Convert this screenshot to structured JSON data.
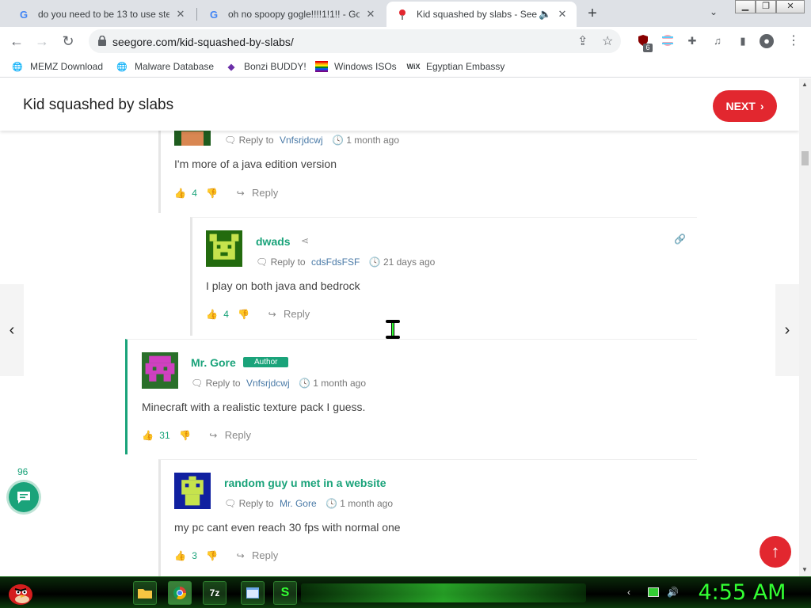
{
  "browser": {
    "tabs": [
      {
        "title": "do you need to be 13 to use stea",
        "favicon": "google-icon"
      },
      {
        "title": "oh no spoopy gogle!!!!1!1!! - Go",
        "favicon": "google-icon"
      },
      {
        "title": "Kid squashed by slabs - See",
        "favicon": "seegore-icon",
        "active": true,
        "audio": true
      }
    ],
    "url": "seegore.com/kid-squashed-by-slabs/",
    "extension_badge": "6",
    "bookmarks": [
      {
        "label": "MEMZ Download",
        "icon": "globe-icon"
      },
      {
        "label": "Malware Database",
        "icon": "globe-icon"
      },
      {
        "label": "Bonzi BUDDY!",
        "icon": "bonzi-icon"
      },
      {
        "label": "Windows ISOs",
        "icon": "rainbow-flag-icon"
      },
      {
        "label": "Egyptian Embassy",
        "icon": "wix-icon"
      }
    ]
  },
  "site": {
    "title": "Kid squashed by slabs",
    "next_label": "NEXT"
  },
  "comments": [
    {
      "name": "",
      "reply_prefix": "Reply to",
      "reply_to": "Vnfsrjdcwj",
      "time": "1 month ago",
      "text": "I'm more of a java edition version",
      "likes": "4",
      "reply_label": "Reply"
    },
    {
      "name": "dwads",
      "reply_prefix": "Reply to",
      "reply_to": "cdsFdsFSF",
      "time": "21 days ago",
      "text": "I play on both java and bedrock",
      "likes": "4",
      "reply_label": "Reply"
    },
    {
      "name": "Mr. Gore",
      "badge": "Author",
      "reply_prefix": "Reply to",
      "reply_to": "Vnfsrjdcwj",
      "time": "1 month ago",
      "text": "Minecraft with a realistic texture pack I guess.",
      "likes": "31",
      "reply_label": "Reply"
    },
    {
      "name": "random guy u met in a website",
      "reply_prefix": "Reply to",
      "reply_to": "Mr. Gore",
      "time": "1 month ago",
      "text": "my pc cant even reach 30 fps with normal one",
      "likes": "3",
      "reply_label": "Reply"
    }
  ],
  "floating": {
    "comment_count": "96"
  },
  "taskbar": {
    "clock": "4:55 AM",
    "items": [
      "folder-icon",
      "chrome-icon",
      "7zip-icon",
      "window-icon",
      "dollar-icon"
    ],
    "item_labels": [
      "",
      "",
      "7z",
      "",
      "S"
    ]
  },
  "colors": {
    "accent_green": "#1aa37a",
    "accent_red": "#e2272f",
    "clock_green": "#33ff33"
  }
}
